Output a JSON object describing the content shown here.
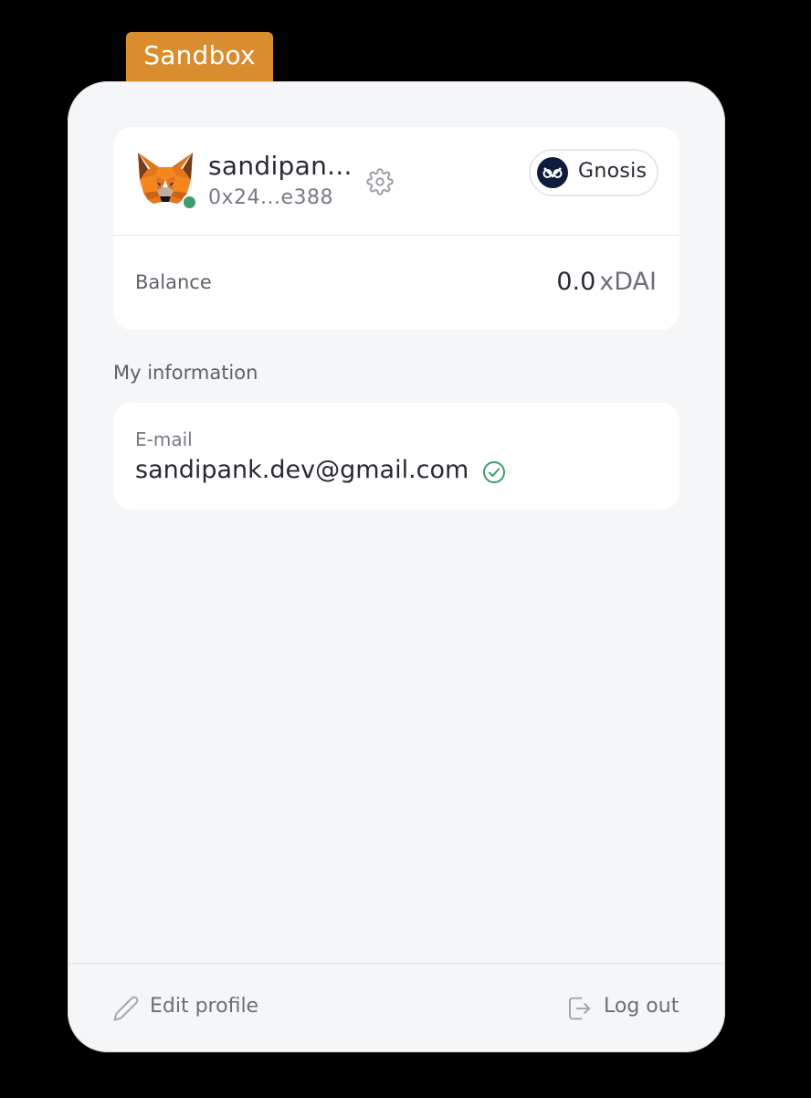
{
  "environment_badge": "Sandbox",
  "wallet": {
    "name": "sandipan...",
    "address": "0x24...e388",
    "avatar_icon": "metamask-fox-icon",
    "status": "online",
    "status_color": "#3c9c6a",
    "network": {
      "label": "Gnosis",
      "icon": "gnosis-owl-icon"
    },
    "balance_label": "Balance",
    "balance_amount": "0.0",
    "balance_unit": "xDAI"
  },
  "my_information": {
    "title": "My information",
    "email_label": "E-mail",
    "email_value": "sandipank.dev@gmail.com",
    "email_verified": true
  },
  "footer": {
    "edit_label": "Edit profile",
    "logout_label": "Log out"
  },
  "colors": {
    "badge": "#d98d2f",
    "panel": "#f5f6f8",
    "card": "#ffffff",
    "verified": "#3c9c6a"
  }
}
